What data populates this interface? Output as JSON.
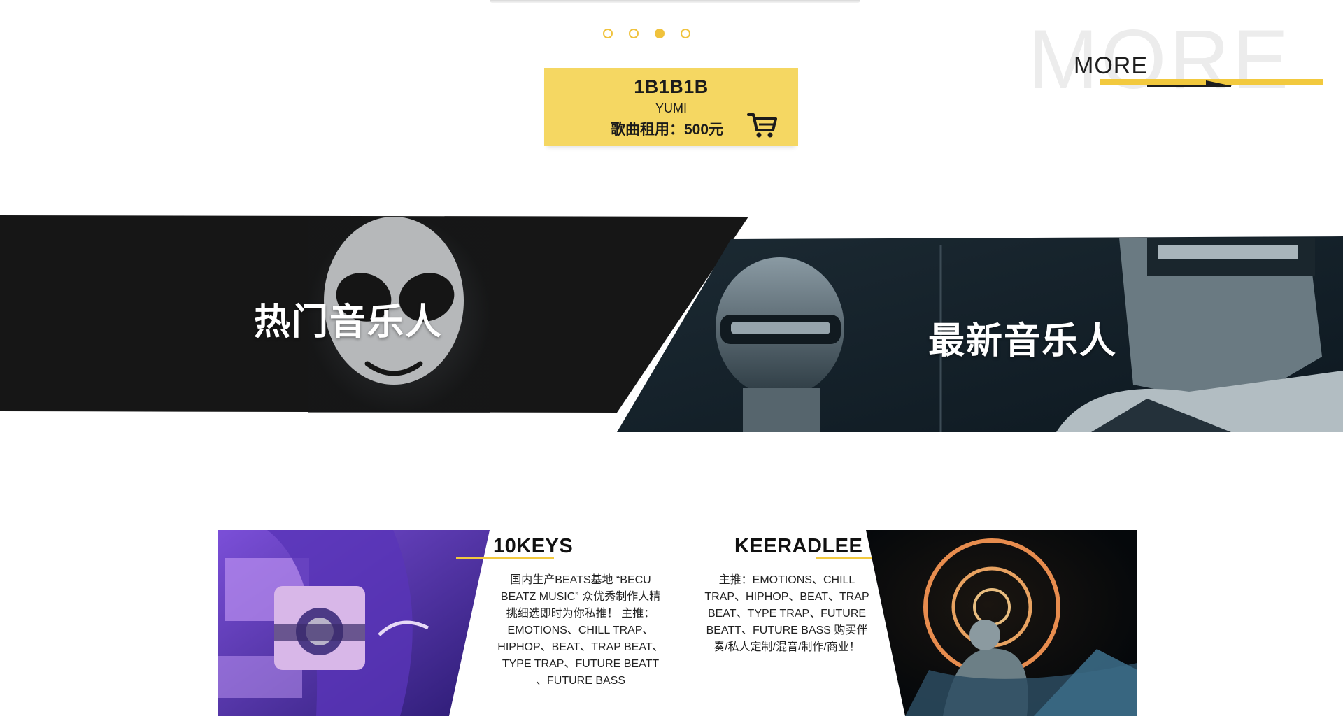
{
  "carousel": {
    "dots": [
      {
        "active": false
      },
      {
        "active": false
      },
      {
        "active": true
      },
      {
        "active": false
      }
    ]
  },
  "song_card": {
    "title": "1B1B1B",
    "artist": "YUMI",
    "price": "歌曲租用：500元",
    "cart_icon": "shopping-cart-icon",
    "background": "#f5d762"
  },
  "more": {
    "bg_text": "MORE",
    "link_text": "MORE",
    "accent": "#f2c93e"
  },
  "banner": {
    "hot_label": "热门音乐人",
    "new_label": "最新音乐人"
  },
  "musicians": [
    {
      "name": "10KEYS",
      "description": [
        "国内生产BEATS基地 “BECU",
        "BEATZ MUSIC” 众优秀制作人精",
        "挑细选即时为你私推！ 主推：",
        "EMOTIONS、CHILL TRAP、",
        "HIPHOP、BEAT、TRAP BEAT、",
        "TYPE TRAP、FUTURE BEATT",
        "、FUTURE BASS"
      ]
    },
    {
      "name": "KEERADLEE",
      "description": [
        "主推：EMOTIONS、CHILL",
        "TRAP、HIPHOP、BEAT、TRAP",
        "BEAT、TYPE TRAP、FUTURE",
        "BEATT、FUTURE BASS 购买伴",
        "奏/私人定制/混音/制作/商业！"
      ]
    }
  ]
}
